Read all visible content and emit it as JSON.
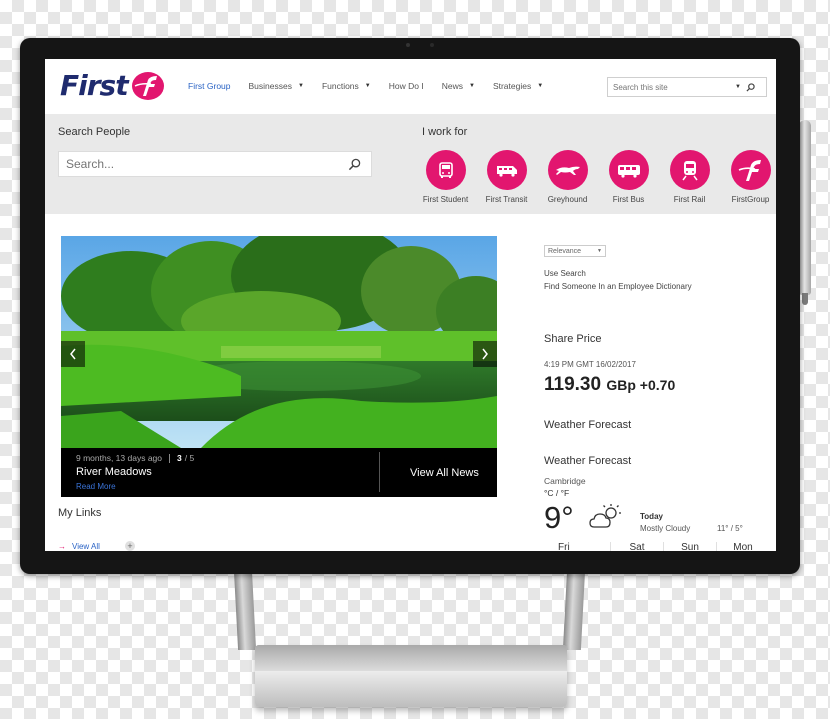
{
  "header": {
    "logo_text": "First",
    "nav": [
      {
        "label": "First Group",
        "active": true,
        "has_menu": false
      },
      {
        "label": "Businesses",
        "active": false,
        "has_menu": true
      },
      {
        "label": "Functions",
        "active": false,
        "has_menu": true
      },
      {
        "label": "How Do I",
        "active": false,
        "has_menu": false
      },
      {
        "label": "News",
        "active": false,
        "has_menu": true
      },
      {
        "label": "Strategies",
        "active": false,
        "has_menu": true
      }
    ],
    "site_search_placeholder": "Search this site"
  },
  "people": {
    "title": "Search People",
    "placeholder": "Search..."
  },
  "i_work_for": {
    "title": "I work for",
    "brands": [
      {
        "label": "First Student",
        "icon": "school-bus-icon"
      },
      {
        "label": "First Transit",
        "icon": "shuttle-bus-icon"
      },
      {
        "label": "Greyhound",
        "icon": "greyhound-dog-icon"
      },
      {
        "label": "First Bus",
        "icon": "bus-icon"
      },
      {
        "label": "First Rail",
        "icon": "train-icon"
      },
      {
        "label": "FirstGroup",
        "icon": "firstgroup-f-icon"
      }
    ]
  },
  "carousel": {
    "meta": "9 months, 13 days ago",
    "index": "3",
    "total": "/ 5",
    "title": "River Meadows",
    "read_more": "Read More",
    "view_all": "View All News"
  },
  "links": {
    "title": "My Links",
    "view_all": "View All"
  },
  "search_tools": {
    "sort": "Relevance",
    "use_search": "Use Search",
    "dictionary": "Find Someone In an Employee Dictionary"
  },
  "share": {
    "title": "Share Price",
    "time": "4:19 PM GMT 16/02/2017",
    "price": "119.30",
    "currency_change": "GBp +0.70"
  },
  "weather": {
    "title1": "Weather Forecast",
    "title2": "Weather Forecast",
    "city": "Cambridge",
    "units": "°C / °F",
    "temp": "9°",
    "icon": "partly-cloudy-icon",
    "today": "Today",
    "condition": "Mostly Cloudy",
    "range": "11° / 5°",
    "days": [
      "Fri",
      "Sat",
      "Sun",
      "Mon"
    ]
  },
  "colors": {
    "brand_pink": "#e2166f",
    "brand_navy": "#1f2b6e",
    "link_blue": "#2a63c5"
  }
}
